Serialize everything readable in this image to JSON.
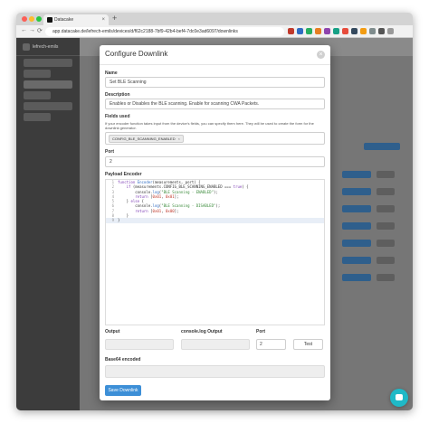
{
  "browser": {
    "tab_title": "Datacake",
    "tab_close": "×",
    "new_tab": "+",
    "url": "app.datacake.de/lefrech-emils/devices/d/f62c2188-7bf9-42b4-bef4-7dc0e3ad6097/downlinks",
    "nav_back": "←",
    "nav_forward": "→",
    "nav_reload": "⟳"
  },
  "app": {
    "workspace": "lefrech-emils"
  },
  "modal": {
    "title": "Configure Downlink",
    "close": "×",
    "name_label": "Name",
    "name_value": "Set BLE Scanning",
    "description_label": "Description",
    "description_value": "Enables or Disables the BLE scanning. Enable for scanning CWA Packets.",
    "fields_label": "Fields used",
    "fields_help": "If your encoder function takes input from the device's fields, you can specify them here. They will be used to create the form for the downlink generator.",
    "field_tag": "CONFIG_BLE_SCANNING_ENABLED",
    "field_tag_remove": "×",
    "port_label": "Port",
    "port_value": "2",
    "encoder_label": "Payload Encoder",
    "output_label": "Output",
    "console_label": "console.log Output",
    "port2_label": "Port",
    "port2_value": "2",
    "test_label": "Test",
    "base64_label": "Base64 encoded",
    "save_label": "Save Downlink"
  },
  "code": {
    "line_numbers": [
      "1",
      "2",
      "3",
      "4",
      "5",
      "6",
      "7",
      "8",
      "9"
    ]
  },
  "colors": {
    "primary": "#3d8fd7",
    "chat": "#1fb9c7"
  }
}
